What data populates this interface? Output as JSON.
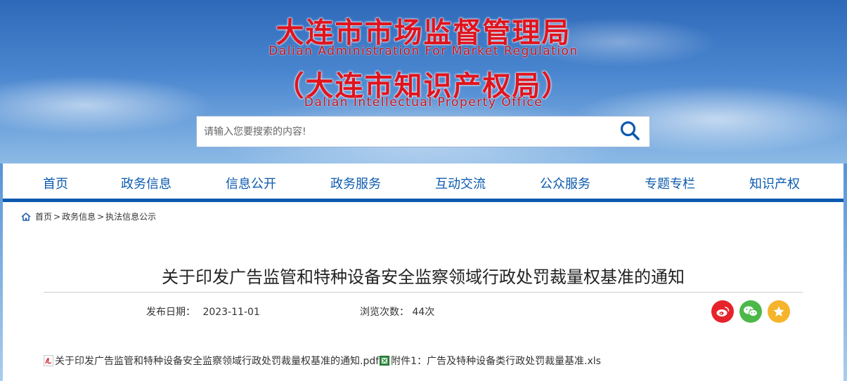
{
  "header": {
    "title_cn": "大连市市场监督管理局",
    "title_en": "Dalian Administration For Market Regulation",
    "subtitle_cn": "（大连市知识产权局）",
    "subtitle_en": "Dalian Intellectual Property Office",
    "search_placeholder": "请输入您要搜索的内容!"
  },
  "nav": {
    "items": [
      "首页",
      "政务信息",
      "信息公开",
      "政务服务",
      "互动交流",
      "公众服务",
      "专题专栏",
      "知识产权"
    ]
  },
  "breadcrumb": {
    "home": "首页",
    "sep": ">",
    "level1": "政务信息",
    "level2": "执法信息公示"
  },
  "article": {
    "title": "关于印发广告监管和特种设备安全监察领域行政处罚裁量权基准的通知",
    "publish_label": "发布日期：",
    "publish_date": "2023-11-01",
    "views_label": "浏览次数：",
    "views_count": "44次"
  },
  "attachments": {
    "file1": "关于印发广告监管和特种设备安全监察领域行政处罚裁量权基准的通知.pdf",
    "file2": "附件1：广告及特种设备类行政处罚裁量基准.xls"
  },
  "colors": {
    "brand_blue": "#0b5aae",
    "title_red": "#e0141e",
    "weibo": "#e6232a",
    "wechat": "#4cb848",
    "favorite": "#f5b42a"
  }
}
